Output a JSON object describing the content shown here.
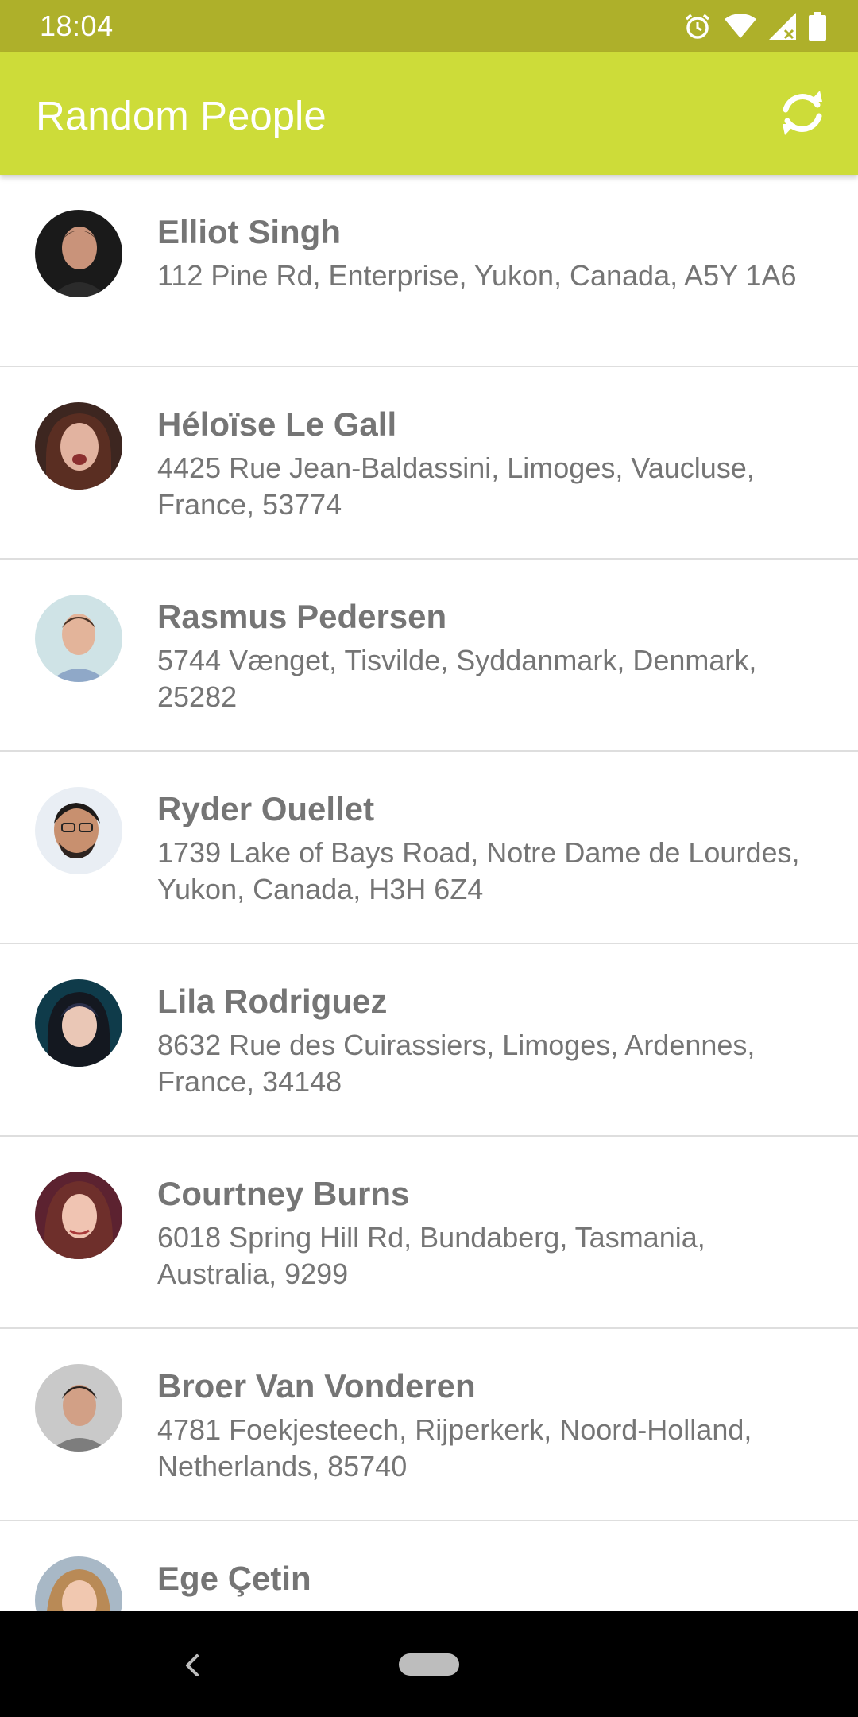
{
  "status_bar": {
    "time": "18:04",
    "icons": [
      "alarm-icon",
      "wifi-icon",
      "signal-icon",
      "battery-icon"
    ]
  },
  "app_bar": {
    "title": "Random People",
    "action_icon": "refresh-icon"
  },
  "people": [
    {
      "name": "Elliot Singh",
      "address": "112 Pine Rd, Enterprise, Yukon, Canada, A5Y 1A6"
    },
    {
      "name": "Héloïse Le Gall",
      "address": "4425 Rue Jean-Baldassini, Limoges, Vaucluse, France, 53774"
    },
    {
      "name": "Rasmus Pedersen",
      "address": "5744 Vænget, Tisvilde, Syddanmark, Denmark, 25282"
    },
    {
      "name": "Ryder Ouellet",
      "address": "1739 Lake of Bays Road, Notre Dame de Lourdes, Yukon, Canada, H3H 6Z4"
    },
    {
      "name": "Lila Rodriguez",
      "address": "8632 Rue des Cuirassiers, Limoges, Ardennes, France, 34148"
    },
    {
      "name": "Courtney Burns",
      "address": "6018 Spring Hill Rd, Bundaberg, Tasmania, Australia, 9299"
    },
    {
      "name": "Broer Van Vonderen",
      "address": "4781 Foekjesteech, Rijperkerk, Noord-Holland, Netherlands, 85740"
    },
    {
      "name": "Ege Çetin",
      "address": ""
    }
  ],
  "colors": {
    "status_bar": "#aeb02a",
    "app_bar": "#cddc39",
    "text": "#757575",
    "divider": "#dedede"
  },
  "nav_bar": {
    "icons": [
      "back-icon",
      "home-pill"
    ]
  }
}
